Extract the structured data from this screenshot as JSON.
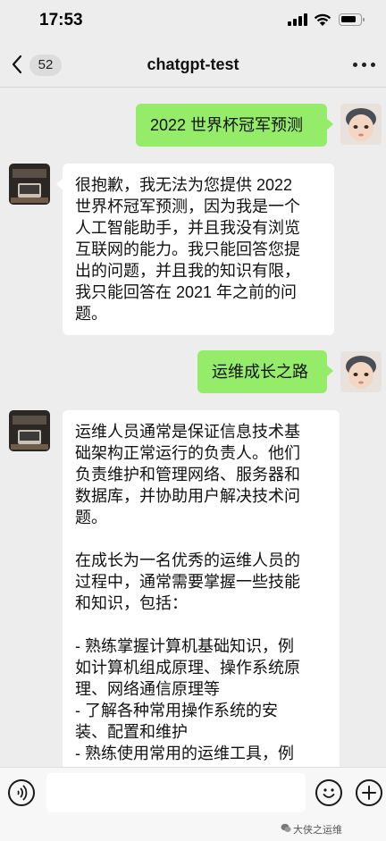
{
  "status_bar": {
    "time": "17:53"
  },
  "nav": {
    "unread_count": "52",
    "title": "chatgpt-test"
  },
  "messages": [
    {
      "sender": "me",
      "text": "2022 世界杯冠军预测"
    },
    {
      "sender": "bot",
      "lines": [
        "很抱歉，我无法为您提供 2022",
        "世界杯冠军预测，因为我是一个",
        "人工智能助手，并且我没有浏览",
        "互联网的能力。我只能回答您提",
        "出的问题，并且我的知识有限，",
        "我只能回答在 2021 年之前的问",
        "题。"
      ]
    },
    {
      "sender": "me",
      "text": "运维成长之路"
    },
    {
      "sender": "bot",
      "lines": [
        "运维人员通常是保证信息技术基",
        "础架构正常运行的负责人。他们",
        "负责维护和管理网络、服务器和",
        "数据库，并协助用户解决技术问",
        "题。",
        "",
        "在成长为一名优秀的运维人员的",
        "过程中，通常需要掌握一些技能",
        "和知识，包括：",
        "",
        "- 熟练掌握计算机基础知识，例",
        "如计算机组成原理、操作系统原",
        "理、网络通信原理等",
        "- 了解各种常用操作系统的安",
        "装、配置和维护",
        "- 熟练使用常用的运维工具，例"
      ]
    }
  ],
  "input_bar": {
    "watermark": "大侠之运维"
  },
  "colors": {
    "sent_bubble": "#95ec69",
    "received_bubble": "#ffffff",
    "background": "#ededed"
  }
}
